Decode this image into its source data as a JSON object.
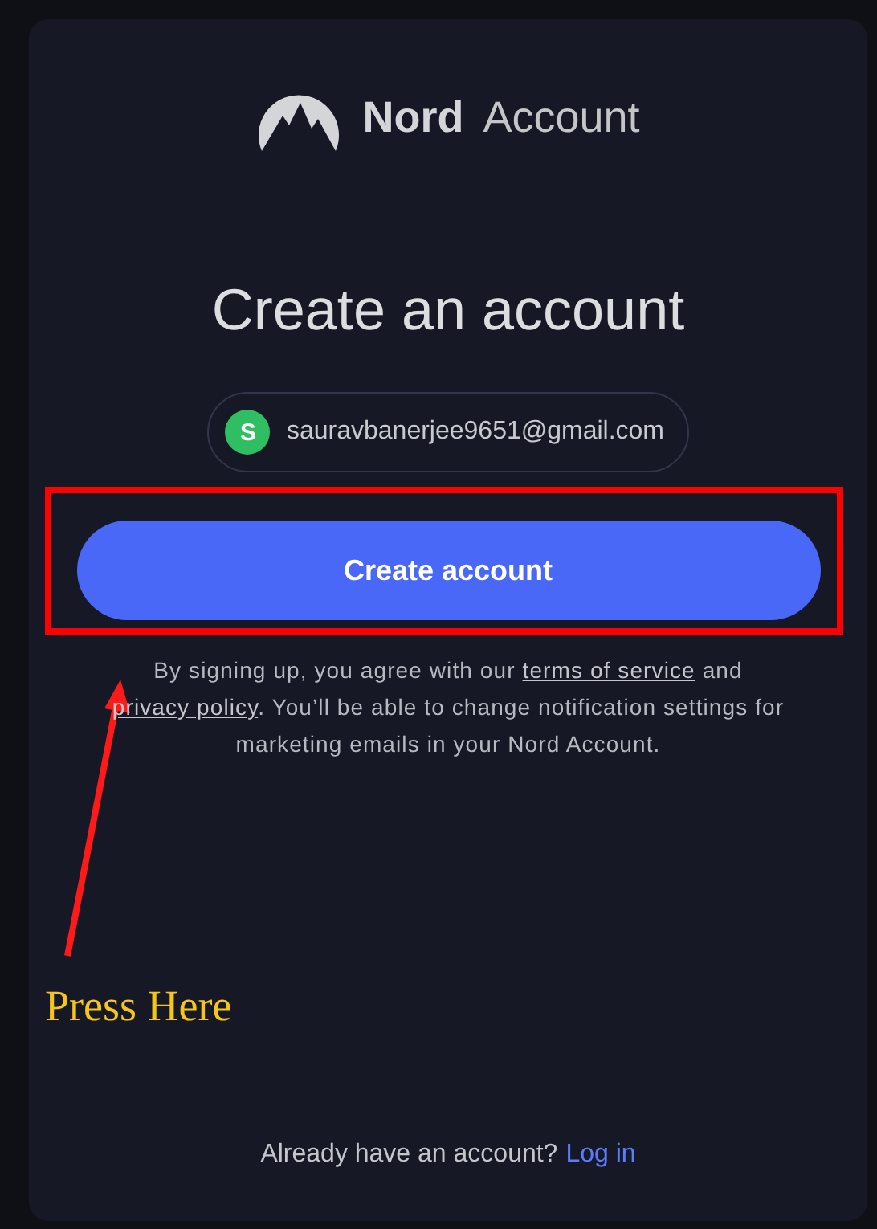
{
  "logo": {
    "brand": "Nord",
    "product": "Account"
  },
  "title": "Create an account",
  "account_chip": {
    "initial": "S",
    "email": "sauravbanerjee9651@gmail.com",
    "color": "#2fbf62"
  },
  "primary_button": {
    "label": "Create account",
    "highlighted": true
  },
  "terms": {
    "before": "By signing up, you agree with our ",
    "terms_link": "terms of service",
    "middle": " and ",
    "privacy_link": "privacy policy",
    "after": ". You’ll be able to change notification settings for marketing emails in your Nord Account."
  },
  "footer": {
    "text": "Already have an account?",
    "link": "Log in"
  },
  "annotation": {
    "label": "Press Here"
  }
}
